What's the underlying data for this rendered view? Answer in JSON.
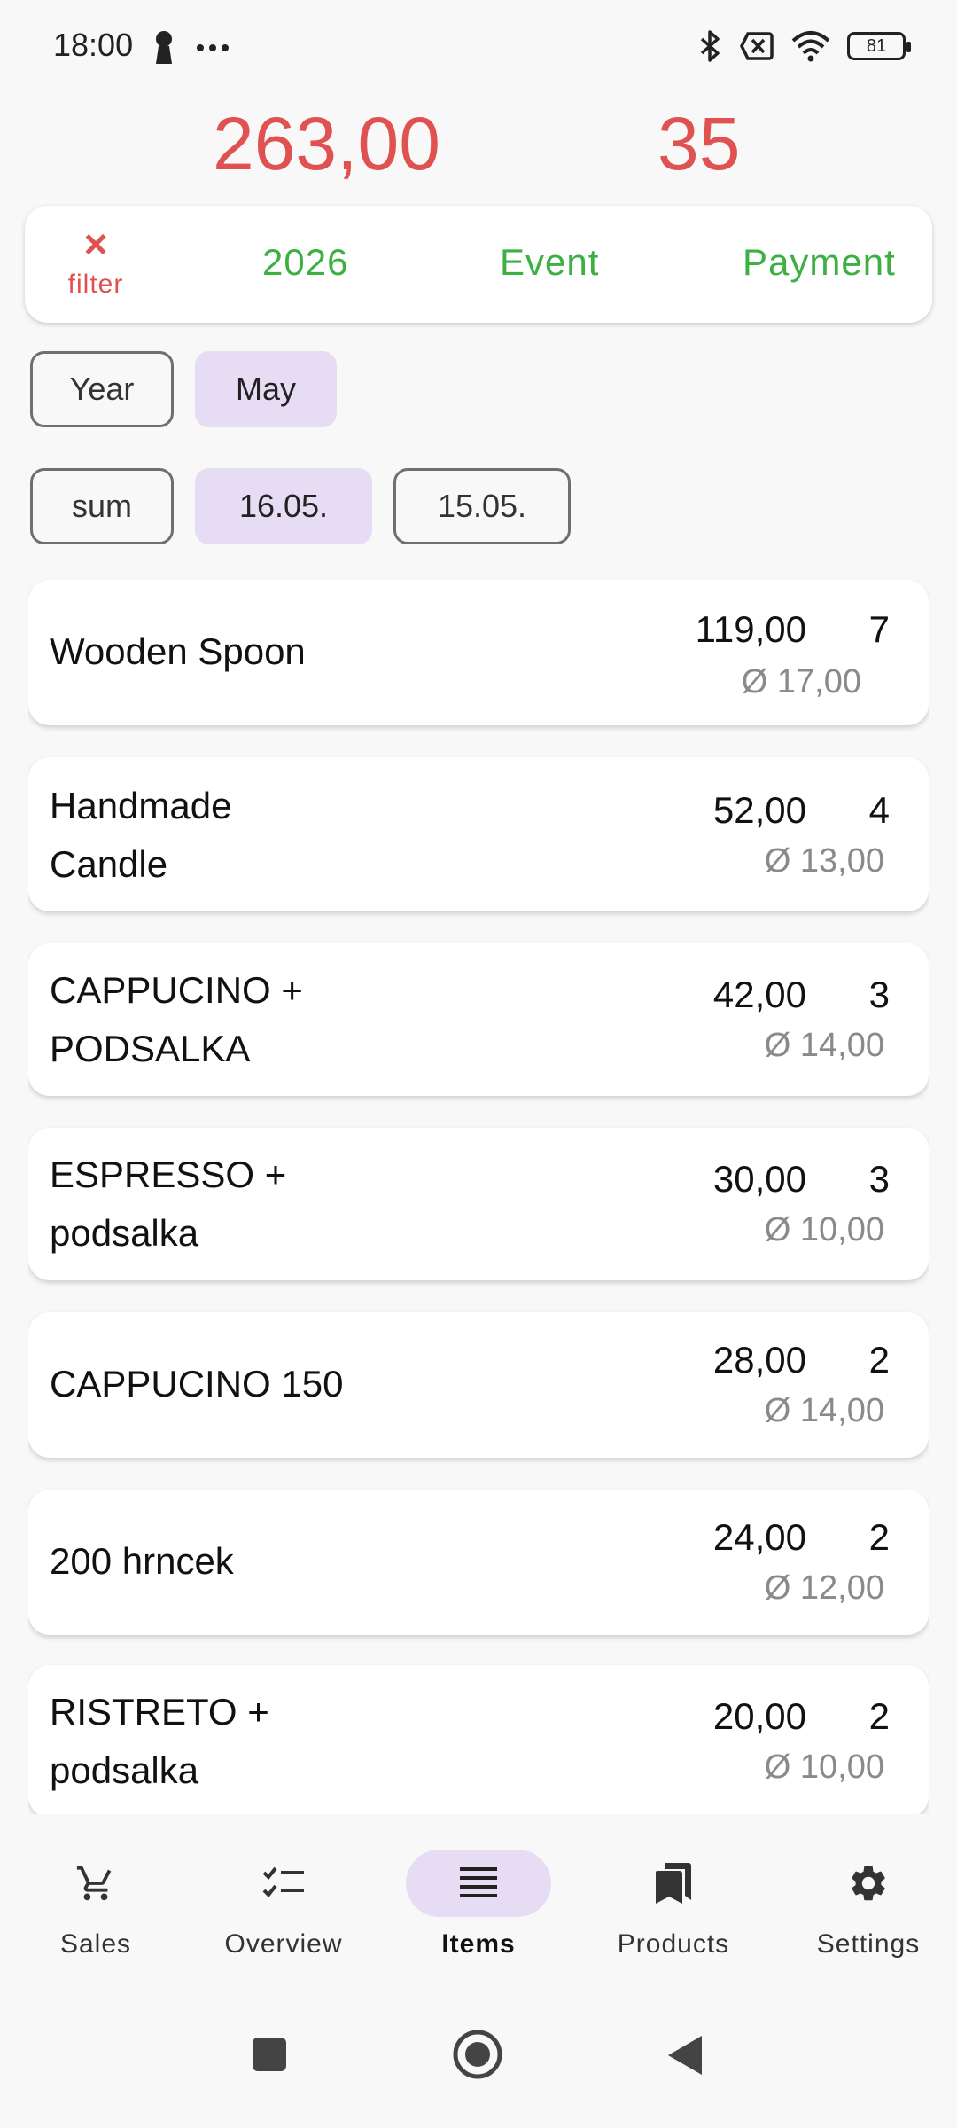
{
  "status_bar": {
    "time": "18:00",
    "battery": "81",
    "icons": [
      "person-icon",
      "more-dots-icon",
      "bluetooth-icon",
      "sim-off-icon",
      "wifi-icon",
      "battery-icon"
    ]
  },
  "totals": {
    "sum": "263,00",
    "count": "35",
    "color": "#e05252"
  },
  "filter": {
    "clear_icon": "×",
    "clear_label": "filter",
    "chips": [
      "2026",
      "Event",
      "Payment"
    ],
    "chip_color": "#3cb043"
  },
  "period_chips": [
    {
      "label": "Year",
      "selected": false
    },
    {
      "label": "May",
      "selected": true
    }
  ],
  "day_chips": [
    {
      "label": "sum",
      "selected": false
    },
    {
      "label": "16.05.",
      "selected": true
    },
    {
      "label": "15.05.",
      "selected": false
    }
  ],
  "items": [
    {
      "name": "Wooden Spoon",
      "total": "119,00",
      "qty": "7",
      "avg": "Ø 17,00"
    },
    {
      "name": " Handmade\nCandle",
      "total": "52,00",
      "qty": "4",
      "avg": "Ø 13,00"
    },
    {
      "name": "CAPPUCINO +\nPODSALKA",
      "total": "42,00",
      "qty": "3",
      "avg": "Ø 14,00"
    },
    {
      "name": "ESPRESSO +\npodsalka",
      "total": "30,00",
      "qty": "3",
      "avg": "Ø 10,00"
    },
    {
      "name": "CAPPUCINO 150",
      "total": "28,00",
      "qty": "2",
      "avg": "Ø 14,00"
    },
    {
      "name": "200 hrncek",
      "total": "24,00",
      "qty": "2",
      "avg": "Ø 12,00"
    },
    {
      "name": "RISTRETO +\npodsalka",
      "total": "20,00",
      "qty": "2",
      "avg": "Ø 10,00"
    }
  ],
  "bottom_nav": [
    {
      "label": "Sales",
      "icon": "cart-icon",
      "active": false
    },
    {
      "label": "Overview",
      "icon": "checklist-icon",
      "active": false
    },
    {
      "label": "Items",
      "icon": "list-icon",
      "active": true
    },
    {
      "label": "Products",
      "icon": "bookmarks-icon",
      "active": false
    },
    {
      "label": "Settings",
      "icon": "gear-icon",
      "active": false
    }
  ],
  "accent_selected": "#e6dcf4"
}
